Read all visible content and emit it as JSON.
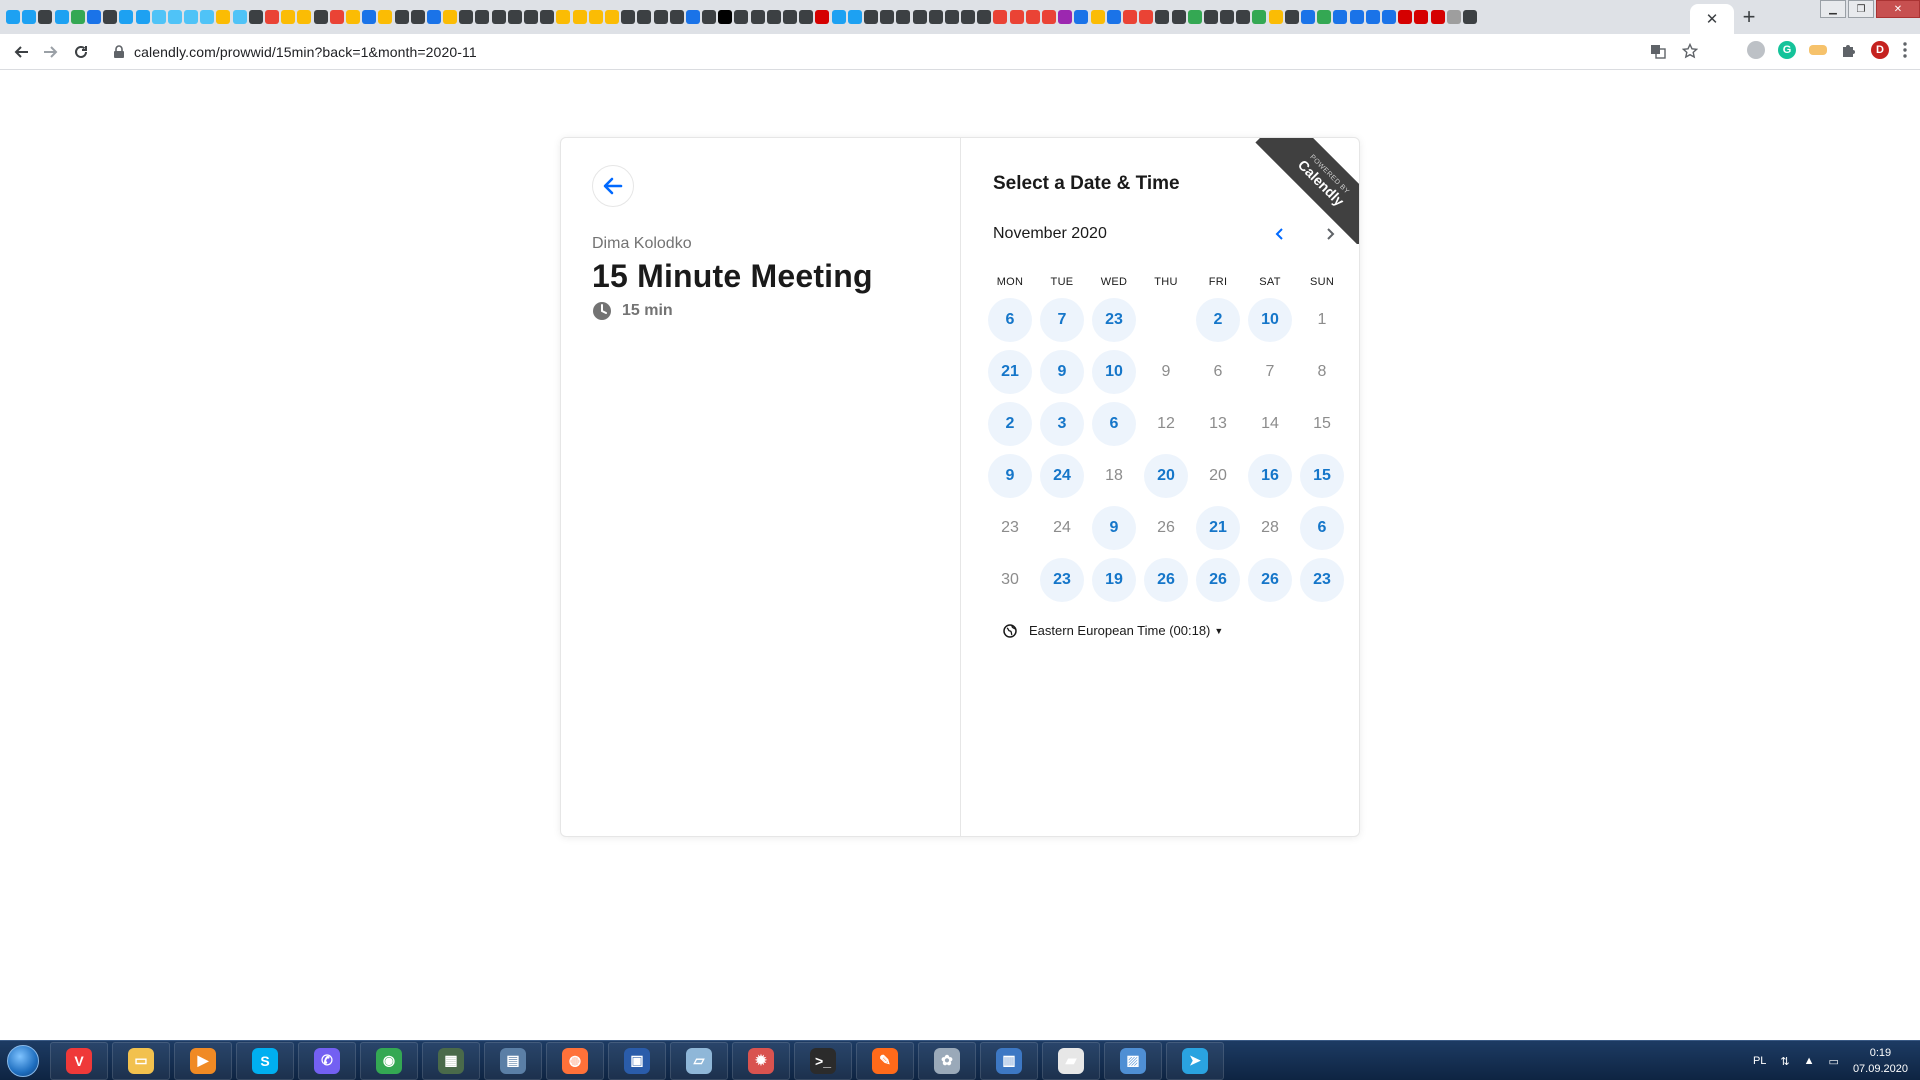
{
  "browser": {
    "url": "calendly.com/prowwid/15min?back=1&month=2020-11",
    "tab_close": "✕",
    "new_tab": "+",
    "profile_initial": "D",
    "pinned_tab_colors": [
      "#1da1f2",
      "#1da1f2",
      "#3c4043",
      "#1da1f2",
      "#34a853",
      "#1a73e8",
      "#3c4043",
      "#1da1f2",
      "#1da1f2",
      "#4fc3f7",
      "#4fc3f7",
      "#4fc3f7",
      "#4fc3f7",
      "#fbbc04",
      "#4fc3f7",
      "#3c4043",
      "#ea4335",
      "#fbbc04",
      "#fbbc04",
      "#3c4043",
      "#ea4335",
      "#fbbc04",
      "#1a73e8",
      "#fbbc04",
      "#3c4043",
      "#3c4043",
      "#1a73e8",
      "#fbbc04",
      "#3c4043",
      "#3c4043",
      "#3c4043",
      "#3c4043",
      "#3c4043",
      "#3c4043",
      "#fbbc04",
      "#fbbc04",
      "#fbbc04",
      "#fbbc04",
      "#3c4043",
      "#3c4043",
      "#3c4043",
      "#3c4043",
      "#1a73e8",
      "#3c4043",
      "#000000",
      "#3c4043",
      "#3c4043",
      "#3c4043",
      "#3c4043",
      "#3c4043",
      "#d50000",
      "#1da1f2",
      "#1da1f2",
      "#3c4043",
      "#3c4043",
      "#3c4043",
      "#3c4043",
      "#3c4043",
      "#3c4043",
      "#3c4043",
      "#3c4043",
      "#ea4335",
      "#ea4335",
      "#ea4335",
      "#ea4335",
      "#9c27b0",
      "#1a73e8",
      "#fbbc04",
      "#1a73e8",
      "#ea4335",
      "#ea4335",
      "#3c4043",
      "#3c4043",
      "#34a853",
      "#3c4043",
      "#3c4043",
      "#3c4043",
      "#34a853",
      "#fbbc04",
      "#3c4043",
      "#1a73e8",
      "#34a853",
      "#1a73e8",
      "#1a73e8",
      "#1a73e8",
      "#1a73e8",
      "#d50000",
      "#d50000",
      "#d50000",
      "#9e9e9e",
      "#3c4043"
    ]
  },
  "event": {
    "host_name": "Dima Kolodko",
    "title": "15 Minute Meeting",
    "duration": "15 min"
  },
  "scheduler": {
    "heading": "Select a Date & Time",
    "month": "November 2020",
    "prev_month_label": "‹",
    "next_month_label": "›",
    "weekdays": [
      "MON",
      "TUE",
      "WED",
      "THU",
      "FRI",
      "SAT",
      "SUN"
    ],
    "days": [
      {
        "label": "6",
        "available": true
      },
      {
        "label": "7",
        "available": true
      },
      {
        "label": "23",
        "available": true
      },
      {
        "label": "",
        "available": false
      },
      {
        "label": "2",
        "available": true
      },
      {
        "label": "10",
        "available": true
      },
      {
        "label": "1",
        "available": false
      },
      {
        "label": "21",
        "available": true
      },
      {
        "label": "9",
        "available": true
      },
      {
        "label": "10",
        "available": true
      },
      {
        "label": "9",
        "available": false
      },
      {
        "label": "6",
        "available": false
      },
      {
        "label": "7",
        "available": false
      },
      {
        "label": "8",
        "available": false
      },
      {
        "label": "2",
        "available": true
      },
      {
        "label": "3",
        "available": true
      },
      {
        "label": "6",
        "available": true
      },
      {
        "label": "12",
        "available": false
      },
      {
        "label": "13",
        "available": false
      },
      {
        "label": "14",
        "available": false
      },
      {
        "label": "15",
        "available": false
      },
      {
        "label": "9",
        "available": true
      },
      {
        "label": "24",
        "available": true
      },
      {
        "label": "18",
        "available": false
      },
      {
        "label": "20",
        "available": true
      },
      {
        "label": "20",
        "available": false
      },
      {
        "label": "16",
        "available": true
      },
      {
        "label": "15",
        "available": true
      },
      {
        "label": "23",
        "available": false
      },
      {
        "label": "24",
        "available": false
      },
      {
        "label": "9",
        "available": true
      },
      {
        "label": "26",
        "available": false
      },
      {
        "label": "21",
        "available": true
      },
      {
        "label": "28",
        "available": false
      },
      {
        "label": "6",
        "available": true
      },
      {
        "label": "30",
        "available": false
      },
      {
        "label": "23",
        "available": true
      },
      {
        "label": "19",
        "available": true
      },
      {
        "label": "26",
        "available": true
      },
      {
        "label": "26",
        "available": true
      },
      {
        "label": "26",
        "available": true
      },
      {
        "label": "23",
        "available": true
      }
    ],
    "timezone": "Eastern European Time (00:18)",
    "badge_small": "POWERED BY",
    "badge_big": "Calendly"
  },
  "taskbar": {
    "apps": [
      {
        "name": "vivaldi",
        "color": "#ef3939",
        "glyph": "V"
      },
      {
        "name": "file-explorer",
        "color": "#f2c14e",
        "glyph": "▭"
      },
      {
        "name": "media-player",
        "color": "#f08a24",
        "glyph": "▶"
      },
      {
        "name": "skype",
        "color": "#00aff0",
        "glyph": "S"
      },
      {
        "name": "viber",
        "color": "#7360f2",
        "glyph": "✆"
      },
      {
        "name": "chrome",
        "color": "#34a853",
        "glyph": "◉"
      },
      {
        "name": "monitor-app",
        "color": "#4a6a4a",
        "glyph": "▦"
      },
      {
        "name": "calculator",
        "color": "#5b7fa6",
        "glyph": "▤"
      },
      {
        "name": "firefox",
        "color": "#ff7139",
        "glyph": "◍"
      },
      {
        "name": "save-app",
        "color": "#2a5caa",
        "glyph": "▣"
      },
      {
        "name": "notepad",
        "color": "#8fb7d8",
        "glyph": "▱"
      },
      {
        "name": "vpn-app",
        "color": "#d9534f",
        "glyph": "✹"
      },
      {
        "name": "terminal",
        "color": "#2b2b2b",
        "glyph": ">_"
      },
      {
        "name": "pen-app",
        "color": "#ff6a1a",
        "glyph": "✎"
      },
      {
        "name": "paint",
        "color": "#9aa9b9",
        "glyph": "✿"
      },
      {
        "name": "remote-desktop",
        "color": "#3d78c4",
        "glyph": "▥"
      },
      {
        "name": "clapper-app",
        "color": "#e7e7e7",
        "glyph": "▰"
      },
      {
        "name": "image-viewer",
        "color": "#4f8fd4",
        "glyph": "▨"
      },
      {
        "name": "telegram",
        "color": "#2aa3e0",
        "glyph": "➤"
      }
    ],
    "language": "PL",
    "time": "0:19",
    "date": "07.09.2020"
  }
}
